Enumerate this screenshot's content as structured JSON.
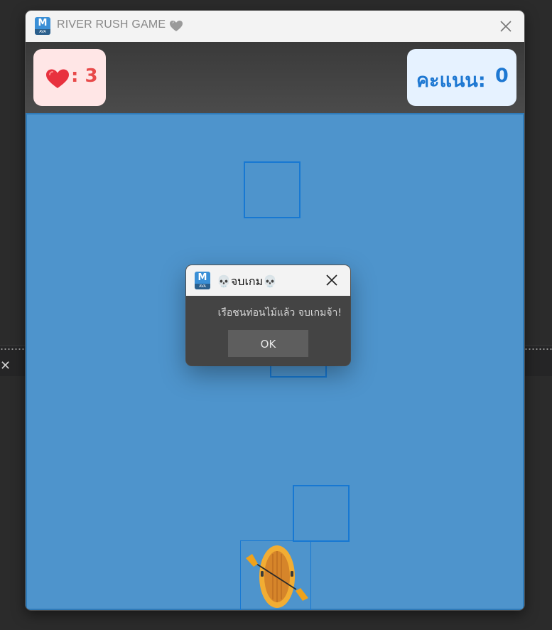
{
  "window": {
    "title": "RIVER RUSH GAME",
    "icon": "avalonia-m-icon",
    "title_heart_icon": "grey-heart-icon",
    "close_icon": "close-icon"
  },
  "hud": {
    "lives_icon": "red-heart-icon",
    "lives_text": ": 3",
    "lives": 3,
    "score_label": "คะแนน:",
    "score_value": "0",
    "score": 0
  },
  "game": {
    "river_color": "#4e94cc",
    "obstacle_border_color": "#1778d2",
    "obstacle_count": 3,
    "boat_icon": "raft-with-paddle-icon"
  },
  "dialog": {
    "title": "💀จบเกม💀",
    "message": "เรือชนท่อนไม้แล้ว จบเกมจ้า!",
    "ok_label": "OK",
    "close_icon": "close-icon"
  }
}
